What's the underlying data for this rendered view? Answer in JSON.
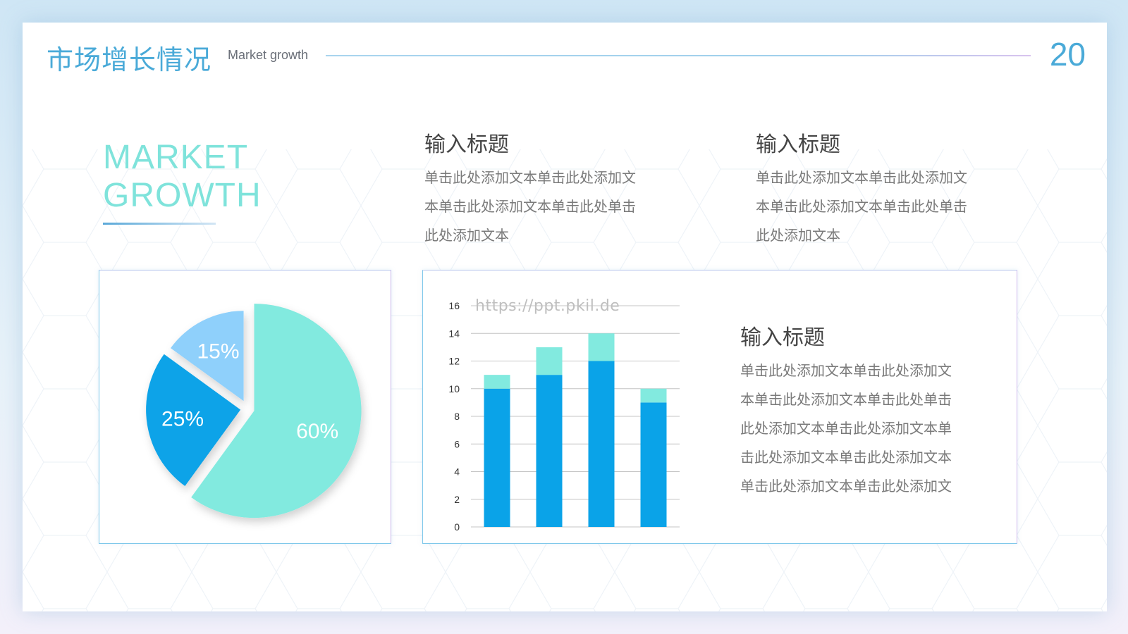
{
  "header": {
    "title_zh": "市场增长情况",
    "title_en": "Market growth",
    "page_number": "20"
  },
  "hero": {
    "line1": "MARKET",
    "line2": "GROWTH"
  },
  "blocks": [
    {
      "title": "输入标题",
      "body": [
        "单击此处添加文本单击此处添加文",
        "本单击此处添加文本单击此处单击",
        "此处添加文本"
      ]
    },
    {
      "title": "输入标题",
      "body": [
        "单击此处添加文本单击此处添加文",
        "本单击此处添加文本单击此处单击",
        "此处添加文本"
      ]
    },
    {
      "title": "输入标题",
      "body": [
        "单击此处添加文本单击此处添加文",
        "本单击此处添加文本单击此处单击",
        "此处添加文本单击此处添加文本单",
        "击此处添加文本单击此处添加文本",
        "单击此处添加文本单击此处添加文"
      ]
    }
  ],
  "watermark": "https://ppt.pkil.de",
  "colors": {
    "accent": "#4aaad8",
    "teal": "#7fe3db",
    "blue": "#0aa3e8",
    "light_blue": "#8fd0fb"
  },
  "chart_data": [
    {
      "type": "pie",
      "slices": [
        {
          "label": "60%",
          "value": 60,
          "color": "#82eadf"
        },
        {
          "label": "25%",
          "value": 25,
          "color": "#0aa3e8"
        },
        {
          "label": "15%",
          "value": 15,
          "color": "#8fd0fb"
        }
      ]
    },
    {
      "type": "bar",
      "stacked": true,
      "categories": [
        "",
        "",
        "",
        ""
      ],
      "series": [
        {
          "values": [
            10,
            11,
            12,
            9
          ],
          "color": "#0aa3e8"
        },
        {
          "values": [
            1,
            2,
            2,
            1
          ],
          "color": "#82eadf"
        }
      ],
      "ylim": [
        0,
        16
      ],
      "yticks": [
        0,
        2,
        4,
        6,
        8,
        10,
        12,
        14,
        16
      ],
      "grid": true
    }
  ]
}
